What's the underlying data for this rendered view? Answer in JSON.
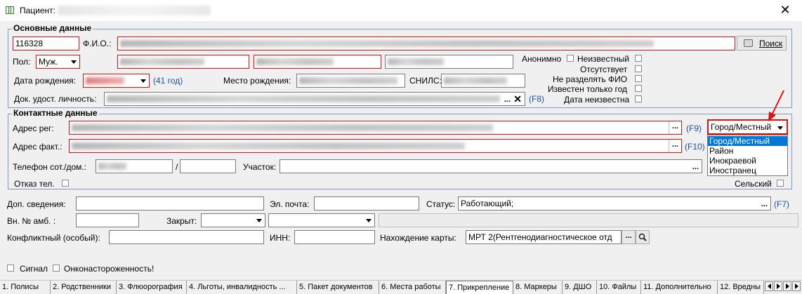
{
  "window": {
    "title": "Пациент:",
    "close_glyph": "✕"
  },
  "basic": {
    "group_title": "Основные данные",
    "id_value": "116328",
    "fio_label": "Ф.И.О.:",
    "search_label": "Поиск",
    "sex_label": "Пол:",
    "sex_value": "Муж.",
    "anon_label": "Анонимно",
    "unknown_label": "Неизвестный",
    "absent_label": "Отсутствует",
    "no_split_label": "Не разделять ФИО",
    "year_only_label": "Известен только год",
    "date_unknown_label": "Дата неизвестна",
    "birth_label": "Дата рождения:",
    "age_text": "(41 год)",
    "birthplace_label": "Место рождения:",
    "snils_label": "СНИЛС:",
    "doc_label": "Док. удост. личность:",
    "doc_hotkey": "(F8)"
  },
  "contact": {
    "group_title": "Контактные данные",
    "addr_reg_label": "Адрес рег:",
    "addr_reg_hotkey": "(F9)",
    "addr_fact_label": "Адрес факт.:",
    "addr_fact_hotkey": "(F10)",
    "phone_label": "Телефон сот./дом.:",
    "phone_sep": "/",
    "area_label": "Участок:",
    "refuse_phone_label": "Отказ тел.",
    "rural_label": "Сельский",
    "locality_select": {
      "value": "Город/Местный",
      "options": [
        "Город/Местный",
        "Район",
        "Инокраевой",
        "Иностранец"
      ],
      "selected_index": 0
    }
  },
  "extra": {
    "extra_info_label": "Доп. сведения:",
    "email_label": "Эл. почта:",
    "status_label": "Статус:",
    "status_value": "Работающий;",
    "status_hotkey": "(F7)",
    "amb_label": "Вн. № амб. :",
    "closed_label": "Закрыт:",
    "conflict_label": "Конфликтный (особый):",
    "inn_label": "ИНН:",
    "card_location_label": "Нахождение карты:",
    "card_location_value": "МРТ 2(Рентгенодиагностическое отд",
    "signal_label": "Сигнал",
    "onco_label": "Онконастороженность!"
  },
  "tabs": [
    "1. Полисы",
    "2. Родственники",
    "3. Флюорография",
    "4. Льготы, инвалидность ...",
    "5. Пакет документов",
    "6. Места работы",
    "7. Прикрепление",
    "8. Маркеры",
    "9. ДШО",
    "10. Файлы",
    "11. Дополнительно",
    "12. Вредны"
  ],
  "active_tab_index": 6,
  "colors": {
    "required_border": "#d11111",
    "hotkey": "#1a4fb0",
    "highlight": "#0078d7",
    "arrow": "#e01010",
    "group_border": "#7a9cc6"
  }
}
